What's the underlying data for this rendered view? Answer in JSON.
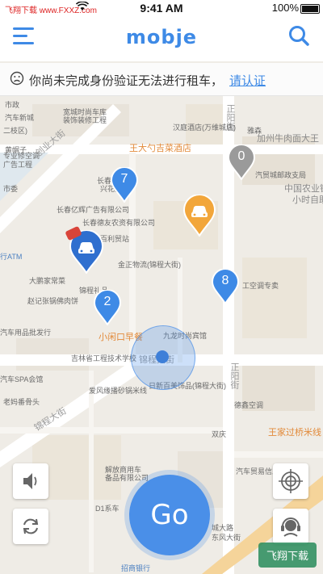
{
  "status_bar": {
    "watermark": "飞翔下载 www.FXXZ.com",
    "time": "9:41 AM",
    "battery": "100%"
  },
  "nav": {
    "logo": "mobje"
  },
  "notice": {
    "message": "你尚未完成身份验证无法进行租车，",
    "link": "请认证"
  },
  "map": {
    "labels": {
      "l1": "市政",
      "l2": "二枝区)",
      "l3": "黄帽子",
      "l4": "专业修空调",
      "l5": "广告工程",
      "l6": "市委",
      "l7": "宽城时尚车库",
      "l8": "装饰装修工程",
      "l9": "创业大街",
      "l10": "长春佳",
      "l11": "兴花园",
      "l12": "王大勺吉菜酒店",
      "l13": "正阳街",
      "l14": "长春亿辉广告有限公司",
      "l15": "长春德友农资有限公司",
      "l16": "百利贸站",
      "l17": "金正物流(锦程大街)",
      "l18": "大鹏家常菜",
      "l19": "赵记张锅佛肉饼",
      "l20": "锦程礼品",
      "l21": "小闲口早餐",
      "l22": "九龙时尚宾馆",
      "l23": "吉林省工程技术学校",
      "l24": "锦程大街",
      "l25": "日新百美饰品(锦程大街)",
      "l26": "爱风缘播砂锅米线",
      "l27": "锦程大街",
      "l28": "德鑫空调",
      "l29": "双庆",
      "l30": "王家过桥米线",
      "l31": "汽车贸易信息",
      "l32": "解放商用车",
      "l33": "备品有限公司",
      "l34": "D1系车",
      "l35": "招商银行",
      "l36": "城大路",
      "l37": "东风大街",
      "l38": "加州牛肉面大王",
      "l39": "汽贸城邮政支局",
      "l40": "中国农业银",
      "l41": "小时自助",
      "l42": "汉庭酒店(万维城店)",
      "l43": "雅森",
      "l44": "行ATM",
      "l45": "汽车用品批发行",
      "l46": "汽车SPA会馆",
      "l47": "老妈番骨头",
      "l48": "工空调专卖",
      "l49": "汽车新城",
      "l50": "正阳街"
    },
    "pins": {
      "pin1": "7",
      "pin2": "0",
      "pin3": "8",
      "pin4": "2"
    }
  },
  "controls": {
    "go_label": "Go"
  },
  "watermark_right": "飞翔下载"
}
